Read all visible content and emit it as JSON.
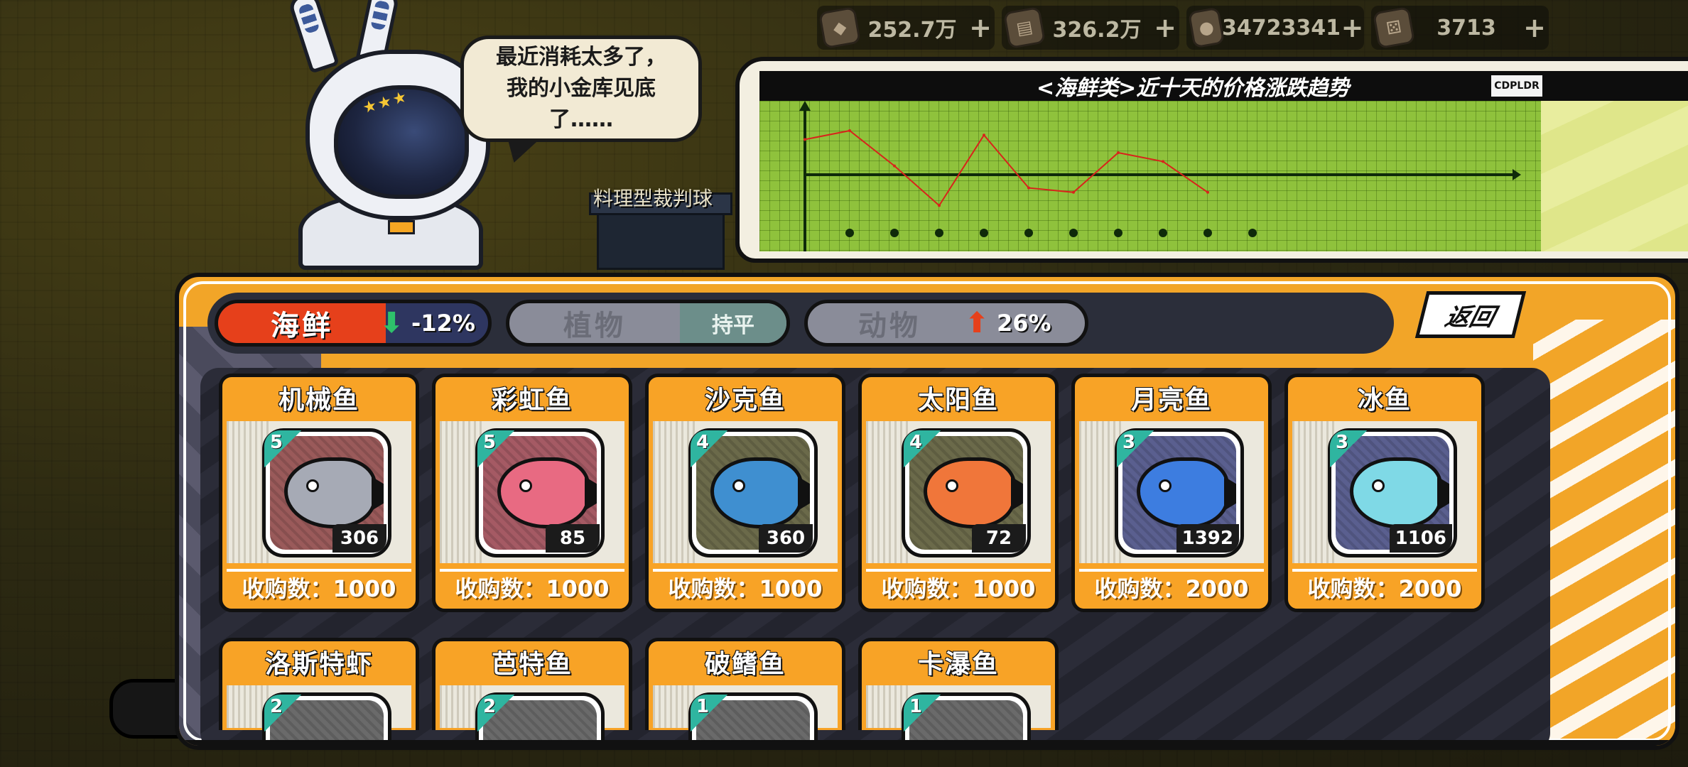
{
  "currencies": [
    {
      "icon": "gem-icon",
      "value": "252.7万"
    },
    {
      "icon": "book-icon",
      "value": "326.2万"
    },
    {
      "icon": "coin-icon",
      "value": "34723341"
    },
    {
      "icon": "dice-icon",
      "value": "3713"
    }
  ],
  "currency_plus": "+",
  "speech": {
    "line1": "最近消耗太多了，",
    "line2": "我的小金库见底",
    "line3": "了……"
  },
  "world_label": "料理型裁判球",
  "trend_chart": {
    "title": "<海鲜类>近十天的价格涨跌趋势",
    "logo": "CDPLDR"
  },
  "chart_data": {
    "type": "line",
    "title": "<海鲜类>近十天的价格涨跌趋势",
    "x": [
      1,
      2,
      3,
      4,
      5,
      6,
      7,
      8,
      9,
      10
    ],
    "series": [
      {
        "values": [
          8,
          10,
          2,
          -7,
          9,
          -3,
          -4,
          5,
          3,
          -4
        ]
      }
    ],
    "ylim": [
      -10,
      12
    ],
    "grid": true
  },
  "categories": {
    "seafood": {
      "name": "海鲜",
      "trend": "-12%",
      "trend_dir": "down",
      "color": "#e6401b"
    },
    "plant": {
      "name": "植物",
      "trend": "持平"
    },
    "animal": {
      "name": "动物",
      "trend": "26%",
      "trend_dir": "up"
    }
  },
  "back_label": "返回",
  "items": [
    {
      "name": "机械鱼",
      "rarity": "5",
      "count": "306",
      "purchase": "收购数：1000",
      "bg": "#9a5a5a",
      "fish": "#a6aab5"
    },
    {
      "name": "彩虹鱼",
      "rarity": "5",
      "count": "85",
      "purchase": "收购数：1000",
      "bg": "#a55a64",
      "fish": "#e86a82"
    },
    {
      "name": "沙克鱼",
      "rarity": "4",
      "count": "360",
      "purchase": "收购数：1000",
      "bg": "#6b6a4a",
      "fish": "#3f8fd0"
    },
    {
      "name": "太阳鱼",
      "rarity": "4",
      "count": "72",
      "purchase": "收购数：1000",
      "bg": "#6b6a4a",
      "fish": "#f0763a"
    },
    {
      "name": "月亮鱼",
      "rarity": "3",
      "count": "1392",
      "purchase": "收购数：2000",
      "bg": "#5a5f8f",
      "fish": "#3d7de0"
    },
    {
      "name": "冰鱼",
      "rarity": "3",
      "count": "1106",
      "purchase": "收购数：2000",
      "bg": "#5a5f8f",
      "fish": "#7fd9e6"
    }
  ],
  "items_partial": [
    {
      "name": "洛斯特虾",
      "rarity": "2"
    },
    {
      "name": "芭特鱼",
      "rarity": "2"
    },
    {
      "name": "破鳍鱼",
      "rarity": "1"
    },
    {
      "name": "卡瀑鱼",
      "rarity": "1"
    }
  ]
}
